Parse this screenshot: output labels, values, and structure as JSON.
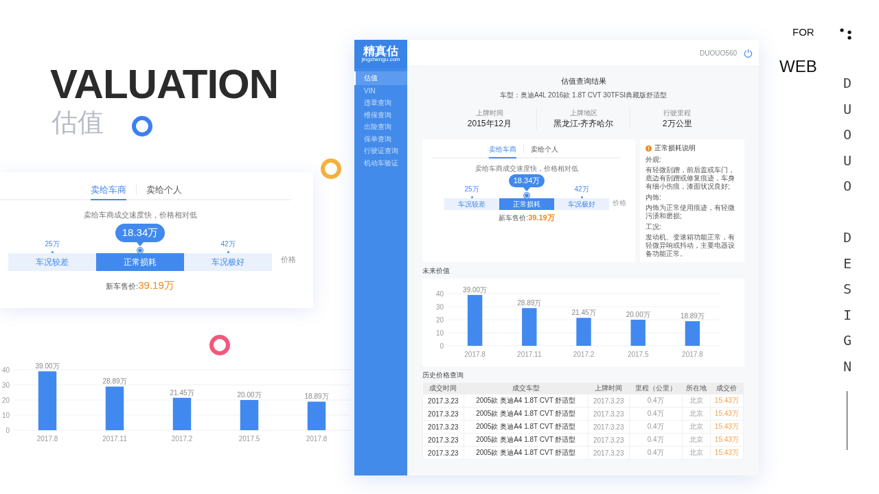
{
  "heading": {
    "title": "VALUATION",
    "subtitle": "估值"
  },
  "side_text": {
    "for": "FOR",
    "web": "WEB",
    "word_1": "DUOUO",
    "word_2": "DESIGN"
  },
  "rings": [
    {
      "color": "#3d7ff2"
    },
    {
      "color": "#f6b13e"
    },
    {
      "color": "#f3587c"
    }
  ],
  "zoom_valuation": {
    "tabs": [
      {
        "label": "卖给车商",
        "selected": true
      },
      {
        "label": "卖给个人",
        "selected": false
      }
    ],
    "note": "卖给车商成交速度快，价格相对低",
    "estimate": "18.34万",
    "segments": [
      {
        "label": "车况较差",
        "tick": "25万",
        "selected": false
      },
      {
        "label": "正常损耗",
        "selected": true
      },
      {
        "label": "车况极好",
        "tick": "42万",
        "selected": false
      }
    ],
    "axis_label": "价格",
    "new_price_label": "新车售价:",
    "new_price": "39.19万"
  },
  "zoom_chart": {
    "chart_data": {
      "type": "bar",
      "categories": [
        "2017.8",
        "2017.11",
        "2017.2",
        "2017.5",
        "2017.8"
      ],
      "values": [
        39,
        28.89,
        21.45,
        20,
        18.89
      ],
      "value_labels": [
        "39.00万",
        "28.89万",
        "21.45万",
        "20.00万",
        "18.89万"
      ],
      "ylim": [
        0,
        40
      ],
      "yticks": [
        0,
        10,
        20,
        30,
        40
      ],
      "grid": true
    }
  },
  "app": {
    "logo": {
      "name": "精真估",
      "domain": "jingzhengu.com"
    },
    "sidebar": {
      "items": [
        {
          "label": "估值",
          "selected": true
        },
        {
          "label": "VIN",
          "selected": false
        },
        {
          "label": "违章查询",
          "selected": false
        },
        {
          "label": "维保查询",
          "selected": false
        },
        {
          "label": "出险查询",
          "selected": false
        },
        {
          "label": "保单查询",
          "selected": false
        },
        {
          "label": "行驶证查询",
          "selected": false
        },
        {
          "label": "机动车验证",
          "selected": false
        }
      ]
    },
    "user": "DUOUO560",
    "title": "估值查询结果",
    "model": "车型：奥迪A4L 2016款 1.8T CVT 30TFSI典藏版舒适型",
    "facts": [
      {
        "label": "上牌时间",
        "value": "2015年12月"
      },
      {
        "label": "上牌地区",
        "value": "黑龙江-齐齐哈尔"
      },
      {
        "label": "行驶里程",
        "value": "2万公里"
      }
    ],
    "valuation": {
      "tabs": [
        {
          "label": "卖给车商",
          "selected": true
        },
        {
          "label": "卖给个人",
          "selected": false
        }
      ],
      "note": "卖给车商成交速度快，价格相对低",
      "estimate": "18.34万",
      "segments": [
        {
          "label": "车况较差",
          "tick": "25万",
          "selected": false
        },
        {
          "label": "正常损耗",
          "selected": true
        },
        {
          "label": "车况极好",
          "tick": "42万",
          "selected": false
        }
      ],
      "axis_label": "价格",
      "new_price_label": "新车售价:",
      "new_price": "39.19万"
    },
    "wear_notes": {
      "title": "正常损耗说明",
      "sections": [
        {
          "heading": "外观:",
          "text": "有轻微刮蹭，前后盖或车门，底边有刮蹭或修复痕迹，车身有细小伤痕，漆面状况良好;"
        },
        {
          "heading": "内饰:",
          "text": "内饰为正常使用痕迹，有轻微污渍和磨损;"
        },
        {
          "heading": "工况:",
          "text": "发动机、变速箱功能正常，有轻微异响或抖动，主要电器设备功能正常。"
        }
      ]
    },
    "future_value": {
      "title": "未来价值",
      "chart_data": {
        "type": "bar",
        "categories": [
          "2017.8",
          "2017.11",
          "2017.2",
          "2017.5",
          "2017.8"
        ],
        "values": [
          39,
          28.89,
          21.45,
          20,
          18.89
        ],
        "value_labels": [
          "39.00万",
          "28.89万",
          "21.45万",
          "20.00万",
          "18.89万"
        ],
        "ylim": [
          0,
          40
        ],
        "yticks": [
          0,
          10,
          20,
          30,
          40
        ],
        "grid": true
      }
    },
    "history": {
      "title": "历史价格查询",
      "columns": [
        "成交时间",
        "成交车型",
        "上牌时间",
        "里程（公里）",
        "所在地",
        "成交价"
      ],
      "rows": [
        [
          "2017.3.23",
          "2005款 奥迪A4 1.8T CVT 舒适型",
          "2017.3.23",
          "0.4万",
          "北京",
          "15.43万"
        ],
        [
          "2017.3.23",
          "2005款 奥迪A4 1.8T CVT 舒适型",
          "2017.3.23",
          "0.4万",
          "北京",
          "15.43万"
        ],
        [
          "2017.3.23",
          "2005款 奥迪A4 1.8T CVT 舒适型",
          "2017.3.23",
          "0.4万",
          "北京",
          "15.43万"
        ],
        [
          "2017.3.23",
          "2005款 奥迪A4 1.8T CVT 舒适型",
          "2017.3.23",
          "0.4万",
          "北京",
          "15.43万"
        ],
        [
          "2017.3.23",
          "2005款 奥迪A4 1.8T CVT 舒适型",
          "2017.3.23",
          "0.4万",
          "北京",
          "15.43万"
        ]
      ]
    }
  }
}
